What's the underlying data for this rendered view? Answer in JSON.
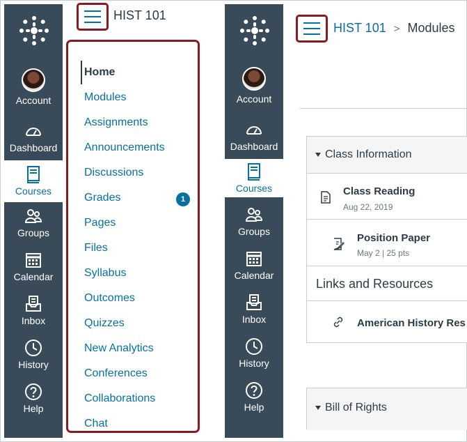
{
  "global_nav": {
    "items": [
      {
        "label": "Account",
        "icon": "avatar"
      },
      {
        "label": "Dashboard",
        "icon": "dashboard-icon"
      },
      {
        "label": "Courses",
        "icon": "courses-icon",
        "active": true
      },
      {
        "label": "Groups",
        "icon": "groups-icon"
      },
      {
        "label": "Calendar",
        "icon": "calendar-icon"
      },
      {
        "label": "Inbox",
        "icon": "inbox-icon"
      },
      {
        "label": "History",
        "icon": "history-icon"
      },
      {
        "label": "Help",
        "icon": "help-icon"
      }
    ]
  },
  "left_panel": {
    "course_title": "HIST 101",
    "course_nav": [
      {
        "label": "Home",
        "active": true
      },
      {
        "label": "Modules"
      },
      {
        "label": "Assignments"
      },
      {
        "label": "Announcements"
      },
      {
        "label": "Discussions"
      },
      {
        "label": "Grades",
        "badge": "1"
      },
      {
        "label": "Pages"
      },
      {
        "label": "Files"
      },
      {
        "label": "Syllabus"
      },
      {
        "label": "Outcomes"
      },
      {
        "label": "Quizzes"
      },
      {
        "label": "New Analytics"
      },
      {
        "label": "Conferences"
      },
      {
        "label": "Collaborations"
      },
      {
        "label": "Chat"
      }
    ]
  },
  "right_panel": {
    "breadcrumb": {
      "course": "HIST 101",
      "separator": ">",
      "page": "Modules"
    },
    "modules": [
      {
        "title": "Class Information",
        "items": [
          {
            "title": "Class Reading",
            "meta": "Aug 22, 2019",
            "icon": "document-icon"
          },
          {
            "title": "Position Paper",
            "meta": "May 2  |  25 pts",
            "icon": "assignment-icon"
          }
        ],
        "subheader": "Links and Resources",
        "link_item": {
          "title": "American History Res",
          "icon": "link-icon"
        }
      },
      {
        "title": "Bill of Rights"
      }
    ]
  },
  "colors": {
    "nav_bg": "#394b58",
    "link": "#0770a3",
    "highlight": "#8b1a20",
    "text": "#2d3b45"
  }
}
